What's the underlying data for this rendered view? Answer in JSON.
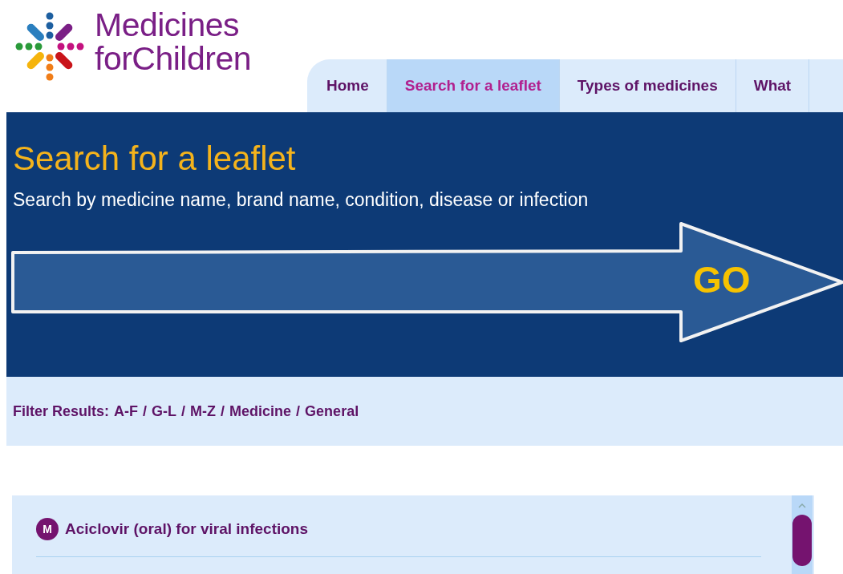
{
  "logo": {
    "line_1": "Medicines",
    "line_2": "forChildren"
  },
  "tabs": [
    {
      "label": "Home",
      "selected": false
    },
    {
      "label": "Search for a leaflet",
      "selected": true
    },
    {
      "label": "Types of medicines",
      "selected": false
    },
    {
      "label": "What",
      "selected": false
    }
  ],
  "banner": {
    "title": "Search for a leaflet",
    "subtitle": "Search by medicine name, brand name, condition, disease or infection",
    "go_label": "GO"
  },
  "filter": {
    "label": "Filter Results:",
    "separator": "/",
    "options": [
      "A-F",
      "G-L",
      "M-Z",
      "Medicine",
      "General"
    ]
  },
  "results": [
    {
      "badge": "M",
      "title": "Aciclovir (oral) for viral infections"
    }
  ]
}
